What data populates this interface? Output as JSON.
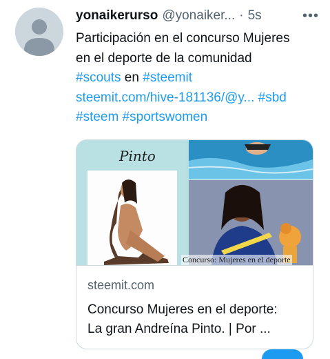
{
  "tweet": {
    "display_name": "yonaikerurso",
    "handle": "@yonaiker...",
    "separator": "·",
    "time": "5s",
    "more_label": "•••",
    "text_line1": "Participación en el concurso Mujeres",
    "text_line2": "en el deporte de la comunidad",
    "hashtag_scouts": "#scouts",
    "word_en": "en",
    "hashtag_steemit": "#steemit",
    "url": "steemit.com/hive-181136/@y...",
    "hashtag_sbd": "#sbd",
    "hashtag_steem": "#steem",
    "hashtag_sportswomen": "#sportswomen"
  },
  "card": {
    "image_label": "Pinto",
    "image_caption": "Concurso: Mujeres en el deporte",
    "domain": "steemit.com",
    "title_line1": "Concurso Mujeres en el deporte:",
    "title_line2": "La gran Andreína Pinto. | Por ..."
  },
  "colors": {
    "link": "#1d9bf0",
    "text": "#0f1419",
    "muted": "#536471",
    "border": "#cfd9de"
  }
}
